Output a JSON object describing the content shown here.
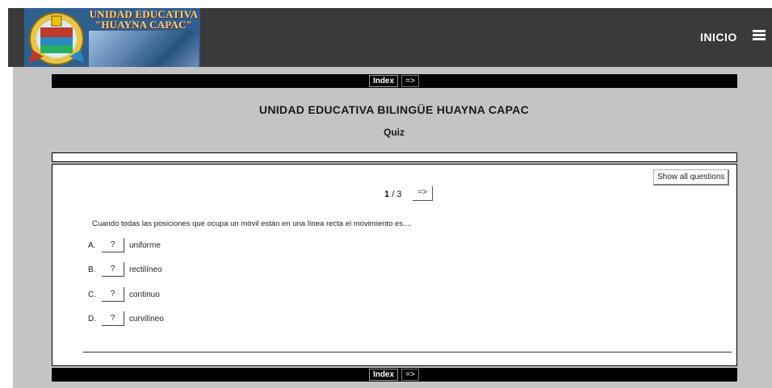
{
  "header": {
    "logo_text_line1": "UNIDAD EDUCATIVA",
    "logo_text_line2": "\"HUAYNA CAPAC\"",
    "nav_label": "INICIO",
    "menu_icon": "hamburger-menu-icon"
  },
  "navbar": {
    "index_label": "Index",
    "next_label": "=>"
  },
  "page": {
    "site_title": "UNIDAD EDUCATIVA BILINGÜE HUAYNA CAPAC",
    "quiz_title": "Quiz"
  },
  "quiz": {
    "show_all_label": "Show all questions",
    "current": "1",
    "total_label": "/ 3",
    "next_label": "=>",
    "question": "Cuando todas las posiciones que ocupa un móvil están en una línea recta el movimiento es....",
    "options": [
      {
        "letter": "A.",
        "answer": "?",
        "text": "uniforme"
      },
      {
        "letter": "B.",
        "answer": "?",
        "text": "rectilíneo"
      },
      {
        "letter": "C.",
        "answer": "?",
        "text": "continuo"
      },
      {
        "letter": "D.",
        "answer": "?",
        "text": "curvilíneo"
      }
    ]
  },
  "colors": {
    "header_bg": "#3a3a3a",
    "main_bg": "#c4c4c4",
    "navbar_bg": "#000000"
  }
}
